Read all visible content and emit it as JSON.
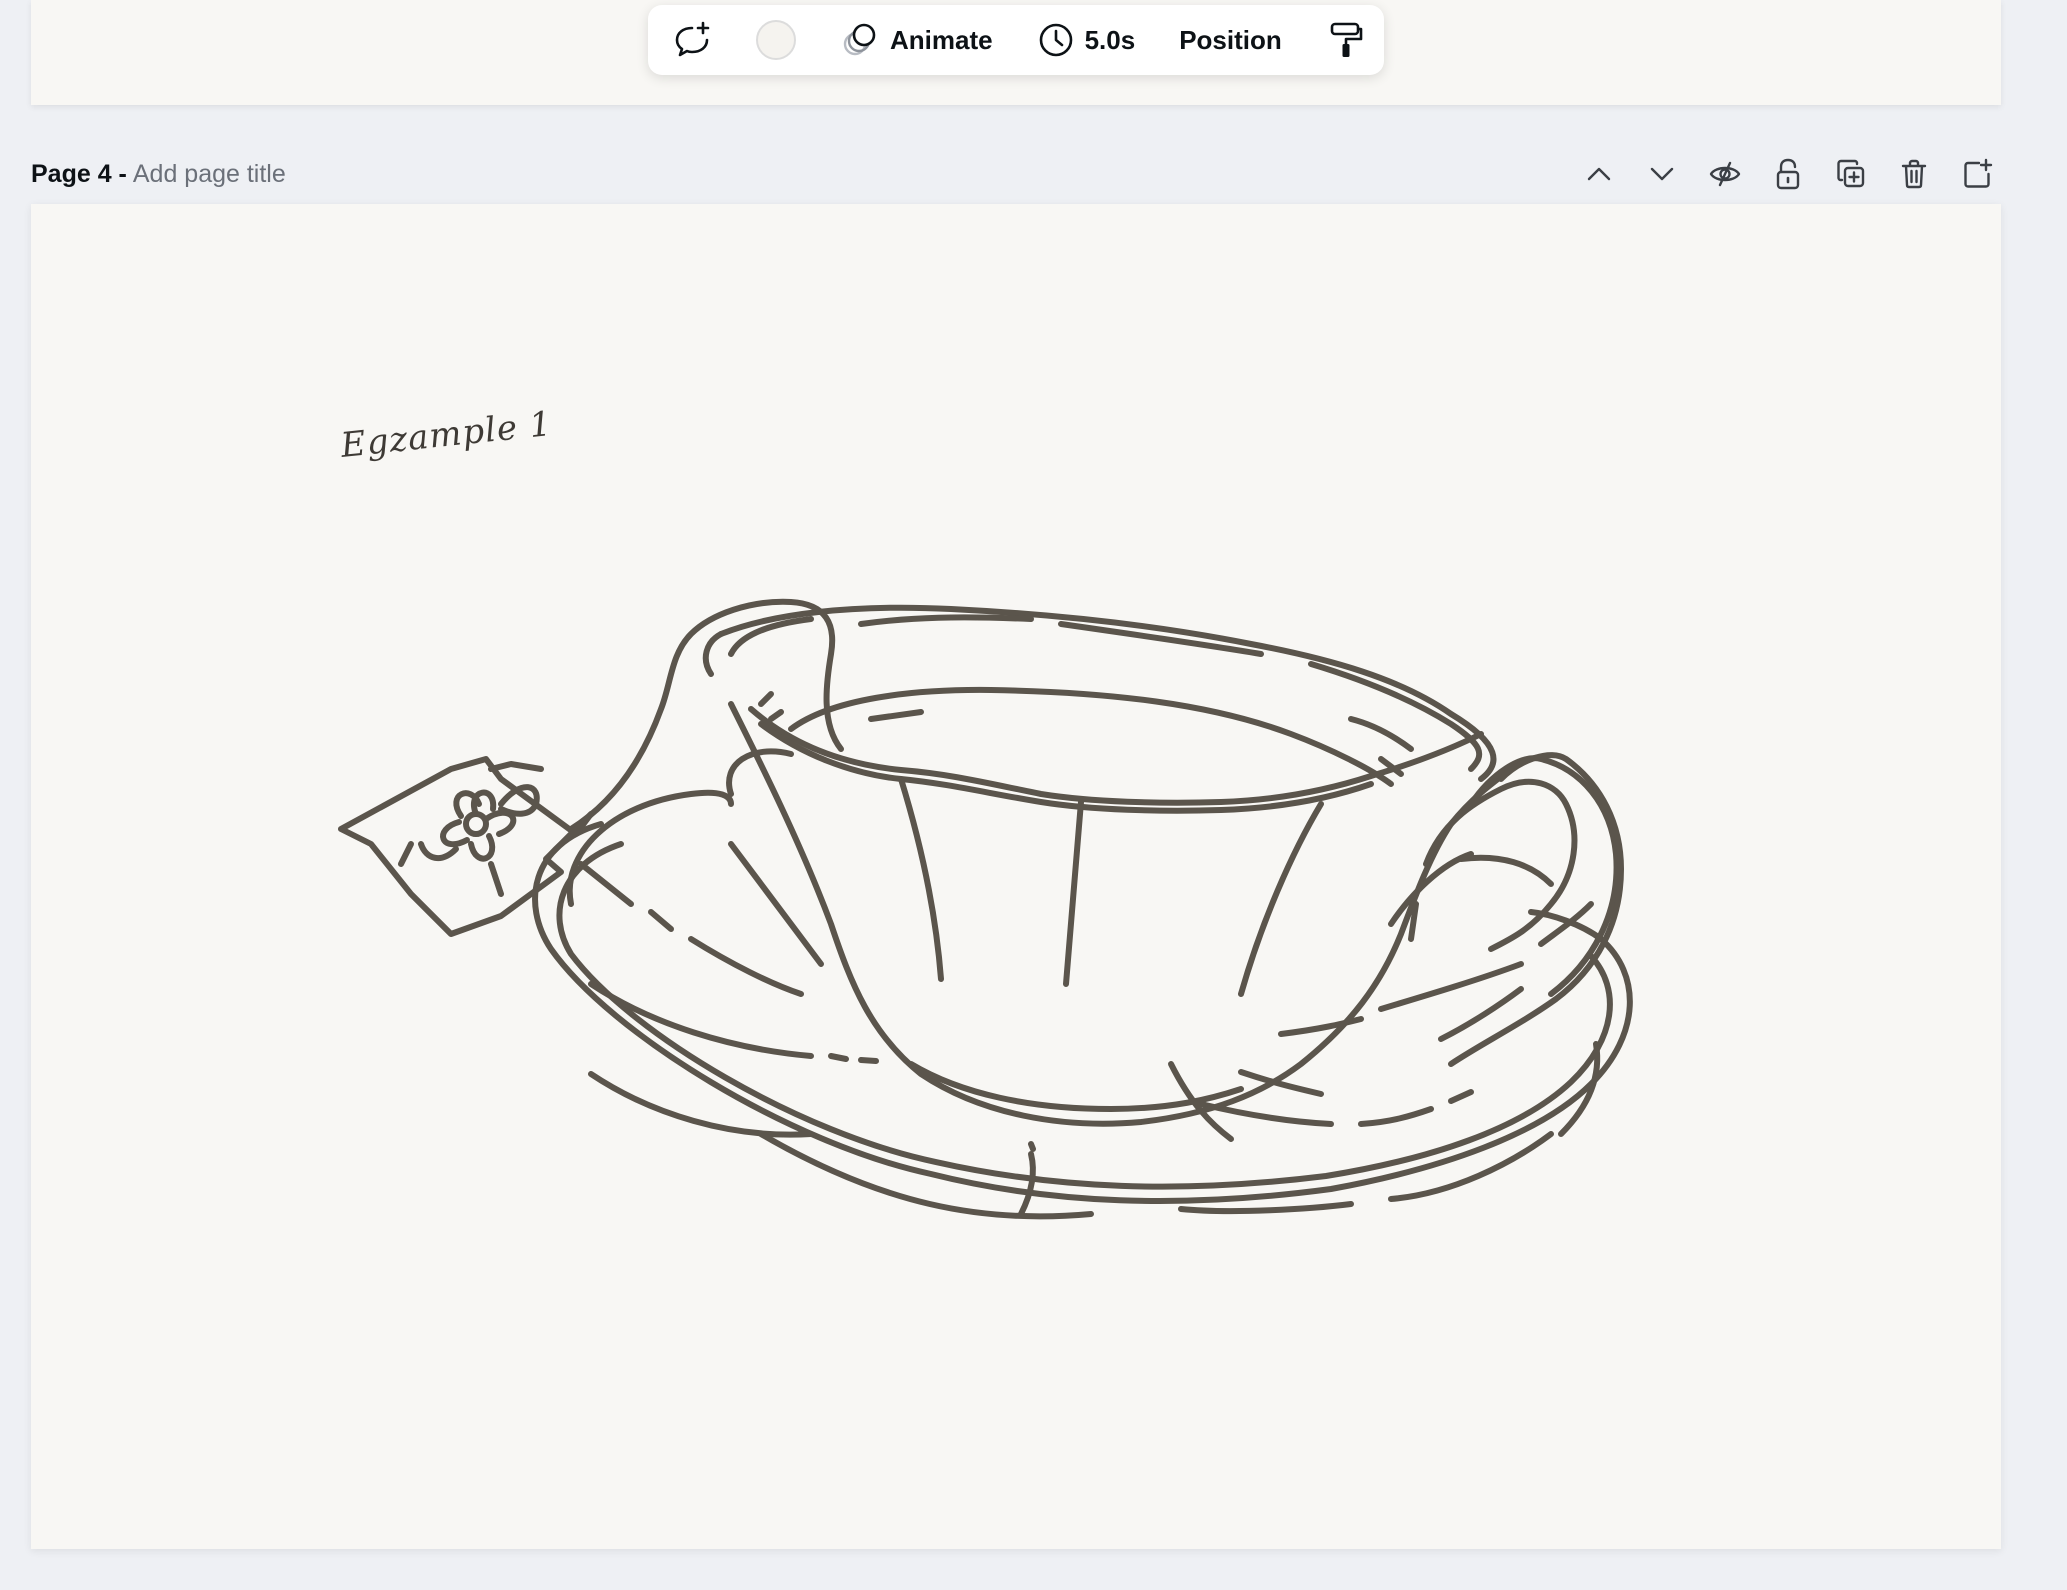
{
  "toolbar": {
    "animate_label": "Animate",
    "duration_label": "5.0s",
    "position_label": "Position",
    "swatch_color": "#f5f3ef"
  },
  "page": {
    "label": "Page 4 -",
    "title_placeholder": "Add page title"
  },
  "canvas": {
    "example_text": "Egzample 1",
    "background": "#f8f7f4",
    "line_color": "#5b554c"
  }
}
